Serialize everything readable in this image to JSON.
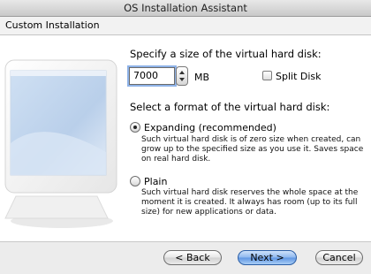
{
  "window": {
    "title": "OS Installation Assistant"
  },
  "header": {
    "title": "Custom Installation"
  },
  "disk_size": {
    "question": "Specify a size of the virtual hard disk:",
    "value": "7000",
    "unit": "MB",
    "split_disk_label": "Split Disk",
    "split_disk_checked": false
  },
  "format": {
    "question": "Select a format of the virtual hard disk:",
    "options": [
      {
        "label": "Expanding (recommended)",
        "selected": true,
        "description": "Such virtual hard disk is of zero size when created, can grow up to the specified size as you use it. Saves space on real hard disk."
      },
      {
        "label": "Plain",
        "selected": false,
        "description": "Such virtual hard disk reserves the whole space at the moment it is created. It always has room (up to its full size) for new applications or data."
      }
    ]
  },
  "buttons": {
    "back": "< Back",
    "next": "Next >",
    "cancel": "Cancel"
  }
}
